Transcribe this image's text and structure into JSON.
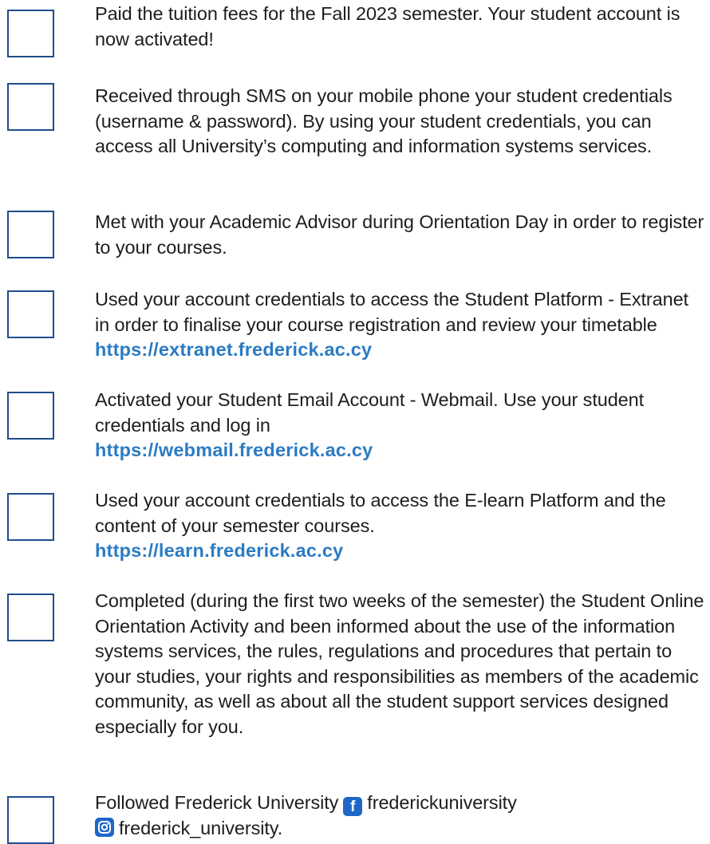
{
  "checklist": {
    "items": [
      {
        "text": "Paid the tuition fees for the Fall 2023 semester. Your student account is now activated!"
      },
      {
        "text": "Received through SMS on your mobile phone your student credentials (username & password). By using your student credentials, you can access all University’s computing and information systems services."
      },
      {
        "text": "Met with your Academic Advisor during Orientation Day in order to register to your courses."
      },
      {
        "text": "Used your account credentials to access the Student Platform - Extranet in order to finalise your course registration and review your timetable ",
        "link": "https://extranet.frederick.ac.cy"
      },
      {
        "text": "Activated your Student Email Account - Webmail. Use your student credentials and log in",
        "link": "https://webmail.frederick.ac.cy"
      },
      {
        "text": "Used your account credentials to access the E-learn Platform and the content of your semester courses.",
        "link": "https://learn.frederick.ac.cy"
      },
      {
        "text": "Completed (during the first two weeks of the semester) the Student Online Orientation Activity and been informed about the use of the information systems services, the rules, regulations and procedures that pertain to your studies, your rights and responsibilities as members of the academic community, as well as about all the student support services designed especially for you."
      },
      {
        "text_before": "Followed Frederick University",
        "facebook_icon": "facebook-icon",
        "facebook_handle": "frederickuniversity",
        "instagram_icon": "instagram-icon",
        "instagram_handle": "frederick_university."
      }
    ]
  },
  "colors": {
    "checkbox_border": "#1f4e8c",
    "link": "#2b7bc3",
    "social_badge": "#1f67c7",
    "text": "#1d1d1b"
  }
}
